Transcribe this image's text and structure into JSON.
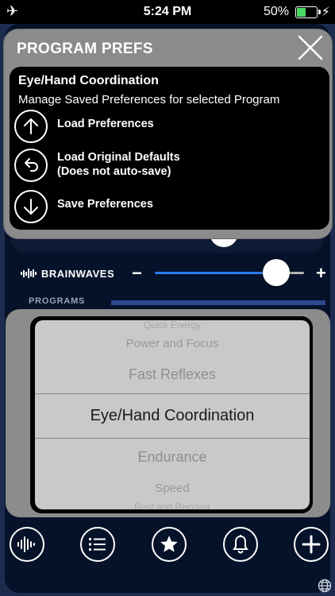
{
  "status_bar": {
    "time": "5:24 PM",
    "battery": "50%"
  },
  "brainwaves": {
    "label": "BRAINWAVES",
    "minus": "−",
    "plus": "+",
    "level": 0.8
  },
  "programs": {
    "label": "PROGRAMS",
    "picker": [
      {
        "text": "Quick Energy"
      },
      {
        "text": "Power and Focus"
      },
      {
        "text": "Fast Reflexes"
      },
      {
        "text": "Eye/Hand Coordination"
      },
      {
        "text": "Endurance"
      },
      {
        "text": "Speed"
      },
      {
        "text": "Rest and Recover"
      }
    ],
    "selected": "Eye/Hand Coordination"
  },
  "toolbar": {
    "icons": [
      "waveform-icon",
      "list-icon",
      "star-icon",
      "bell-icon",
      "plus-icon"
    ]
  },
  "modal": {
    "title": "PROGRAM PREFS",
    "program_name": "Eye/Hand Coordination",
    "subtitle": "Manage Saved Preferences for selected Program",
    "options": [
      {
        "line1": "Load Preferences",
        "line2": ""
      },
      {
        "line1": "Load Original Defaults",
        "line2": "(Does not auto-save)"
      },
      {
        "line1": "Save Preferences",
        "line2": ""
      }
    ]
  },
  "colors": {
    "accent_blue": "#2a7cf4",
    "battery_green": "#4cd964",
    "modal_gray": "#8b8b8b"
  }
}
